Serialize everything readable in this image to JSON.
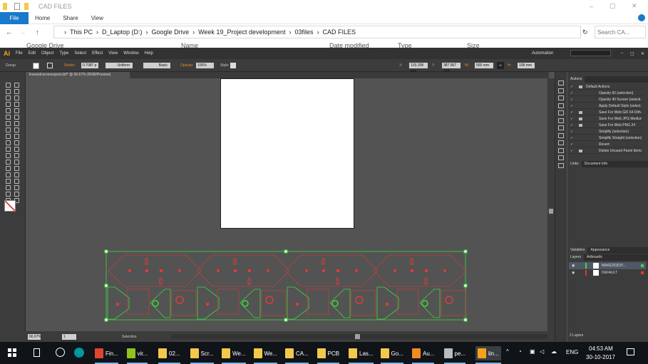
{
  "explorer": {
    "title": "CAD FILES",
    "ribbon_tabs": [
      "File",
      "Home",
      "Share",
      "View"
    ],
    "breadcrumb": [
      "This PC",
      "D_Laptop (D:)",
      "Google Drive",
      "Week 19_Project development",
      "03files",
      "CAD FILES"
    ],
    "search_placeholder": "Search CA...",
    "nav_item": "Google Drive",
    "columns": [
      "Name",
      "Date modified",
      "Type",
      "Size"
    ]
  },
  "illustrator": {
    "logo": "Ai",
    "menu": [
      "File",
      "Edit",
      "Object",
      "Type",
      "Select",
      "Effect",
      "View",
      "Window",
      "Help"
    ],
    "workspace": "Automation",
    "control": {
      "selection": "Group",
      "stroke_label": "Stroke:",
      "stroke_value": "0.7087 p",
      "profile": "Uniform",
      "brush": "Basic",
      "opacity_label": "Opacity:",
      "opacity": "100%",
      "style_label": "Style:",
      "x_label": "X:",
      "x": "103.208 mm",
      "y_label": "Y:",
      "y": "387.967 mm",
      "w_label": "W:",
      "w": "565 mm",
      "h_label": "H:",
      "h": "108 mm"
    },
    "document_tab": "lineandcurvesexport.dxf* @ 66.67% (RGB/Preview)",
    "actions_panel": {
      "tabs": [
        "Actions"
      ],
      "items": [
        {
          "label": "Default Actions",
          "folder": true,
          "dialog": true
        },
        {
          "label": "Opacity 60 (selection)",
          "dialog": false
        },
        {
          "label": "Opacity 40 Screen (selecti...",
          "dialog": false
        },
        {
          "label": "Apply Default Style (select...",
          "dialog": false
        },
        {
          "label": "Save For Web GIF 64 Dith...",
          "dialog": true
        },
        {
          "label": "Save For Web JPG Medium",
          "dialog": true
        },
        {
          "label": "Save For Web PNG 24",
          "dialog": true
        },
        {
          "label": "Simplify (selection)",
          "dialog": false
        },
        {
          "label": "Simplify Straight (selection)",
          "dialog": false
        },
        {
          "label": "Revert",
          "dialog": false
        },
        {
          "label": "Delete Unused Panel Items",
          "dialog": true
        }
      ]
    },
    "links_tabs": [
      "Links",
      "Document Info"
    ],
    "variables_tabs": [
      "Variables",
      "Appearance"
    ],
    "layers_tabs": [
      "Layers",
      "Artboards"
    ],
    "layers": [
      {
        "name": "MAKE3D|D|Y...",
        "color": "#3fd63f"
      },
      {
        "name": "DEFAULT",
        "color": "#e03a3a"
      }
    ],
    "layers_count": "2 Layers",
    "status": {
      "zoom": "66.67%",
      "artboard": "1",
      "tool": "Selection"
    }
  },
  "taskbar": {
    "items": [
      {
        "label": "Fin...",
        "icon": "chrome-icon",
        "color": "#e0452f"
      },
      {
        "label": "vir...",
        "icon": "muse-icon",
        "color": "#8fc31f"
      },
      {
        "label": "02...",
        "icon": "folder-icon",
        "color": "#f2c94c"
      },
      {
        "label": "Scr...",
        "icon": "folder-icon",
        "color": "#f2c94c"
      },
      {
        "label": "We...",
        "icon": "folder-icon",
        "color": "#f2c94c"
      },
      {
        "label": "We...",
        "icon": "folder-icon",
        "color": "#f2c94c"
      },
      {
        "label": "CA...",
        "icon": "folder-icon",
        "color": "#f2c94c"
      },
      {
        "label": "PCB",
        "icon": "folder-icon",
        "color": "#f2c94c"
      },
      {
        "label": "Las...",
        "icon": "folder-icon",
        "color": "#f2c94c"
      },
      {
        "label": "Go...",
        "icon": "google-drive-folder-icon",
        "color": "#f2c94c"
      },
      {
        "label": "Au...",
        "icon": "fusion-icon",
        "color": "#f08a24"
      },
      {
        "label": "pe...",
        "icon": "inkscape-icon",
        "color": "#bbbbbb"
      },
      {
        "label": "lin...",
        "icon": "illustrator-icon",
        "color": "#f7a21b"
      }
    ],
    "language": "ENG",
    "time": "04:53 AM",
    "date": "30-10-2017"
  },
  "colors": {
    "accent": "#1979ca",
    "cut_red": "#e03a3a",
    "cut_green": "#3fd63f"
  }
}
